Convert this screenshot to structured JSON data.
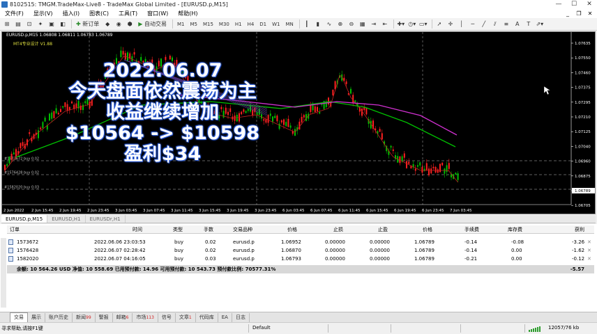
{
  "window": {
    "title": "8102515: TMGM.TradeMax-Live8 - TradeMax Global Limited - [EURUSD.p,M15]"
  },
  "menu": [
    "文件(F)",
    "显示(V)",
    "插入(I)",
    "图表(C)",
    "工具(T)",
    "窗口(W)",
    "帮助(H)"
  ],
  "toolbar": {
    "new_order": "新订单",
    "autotrade": "自动交易",
    "timeframes": [
      "M1",
      "M5",
      "M15",
      "M30",
      "H1",
      "H4",
      "D1",
      "W1",
      "MN"
    ]
  },
  "chart": {
    "symbol_header": "EURUSD.p,M15  1.06808 1.06811 1.06783 1.06789",
    "indicator_label": "MT4专业设计 V1.88",
    "overlay_lines": [
      "2022.06.07",
      "今天盘面依然震荡为主",
      "收益继续增加",
      "$10564 -> $10598",
      "盈利$34"
    ],
    "price_labels": [
      "1.07635",
      "1.07550",
      "1.07460",
      "1.07375",
      "1.07295",
      "1.07210",
      "1.07125",
      "1.07040",
      "1.06960",
      "1.06875",
      "1.06789",
      "1.06705"
    ],
    "current_price": "1.06789",
    "time_labels": [
      "2 Jun 2022",
      "2 Jun 15:45",
      "2 Jun 19:45",
      "2 Jun 23:45",
      "3 Jun 03:45",
      "3 Jun 07:45",
      "3 Jun 11:45",
      "3 Jun 15:45",
      "3 Jun 19:45",
      "3 Jun 23:45",
      "6 Jun 03:45",
      "6 Jun 07:45",
      "6 Jun 11:45",
      "6 Jun 15:45",
      "6 Jun 19:45",
      "6 Jun 23:45",
      "7 Jun 03:45"
    ],
    "order_lines": [
      "#1573672 buy 0.02",
      "#1576428 buy 0.02",
      "#1582020 buy 0.03"
    ],
    "colors": {
      "up_candle": "#00c000",
      "down_candle": "#ff2020",
      "ma_magenta": "#d030d0",
      "ma_green": "#00c000",
      "ma_red": "#c02020",
      "order_line": "#808080"
    }
  },
  "chart_tabs": [
    "EURUSD.p,M15",
    "EURUSD,H1",
    "EURUSDr,H1"
  ],
  "terminal": {
    "columns": [
      "订单",
      "时间",
      "类型",
      "手数",
      "交易品种",
      "价格",
      "止损",
      "止盈",
      "价格",
      "手续费",
      "库存费",
      "获利"
    ],
    "orders": [
      {
        "ticket": "1573672",
        "time": "2022.06.06 23:03:53",
        "type": "buy",
        "lots": "0.02",
        "symbol": "eurusd.p",
        "open_price": "1.06952",
        "sl": "0.00000",
        "tp": "0.00000",
        "price": "1.06789",
        "commission": "-0.14",
        "swap": "-0.08",
        "profit": "-3.26"
      },
      {
        "ticket": "1576428",
        "time": "2022.06.07 02:28:42",
        "type": "buy",
        "lots": "0.02",
        "symbol": "eurusd.p",
        "open_price": "1.06870",
        "sl": "0.00000",
        "tp": "0.00000",
        "price": "1.06789",
        "commission": "-0.14",
        "swap": "0.00",
        "profit": "-1.62"
      },
      {
        "ticket": "1582020",
        "time": "2022.06.07 04:16:05",
        "type": "buy",
        "lots": "0.03",
        "symbol": "eurusd.p",
        "open_price": "1.06793",
        "sl": "0.00000",
        "tp": "0.00000",
        "price": "1.06789",
        "commission": "-0.21",
        "swap": "0.00",
        "profit": "-0.12"
      }
    ],
    "balance_text": "余额: 10 564.26 USD  净值: 10 558.69  已用预付款: 14.96  可用预付款: 10 543.73  预付款比例: 70577.31%",
    "total_profit": "-5.57"
  },
  "bottom_tabs": [
    {
      "label": "交易",
      "badge": ""
    },
    {
      "label": "展示",
      "badge": ""
    },
    {
      "label": "账户历史",
      "badge": ""
    },
    {
      "label": "新闻",
      "badge": "99"
    },
    {
      "label": "警报",
      "badge": ""
    },
    {
      "label": "邮箱",
      "badge": "6"
    },
    {
      "label": "市场",
      "badge": "113"
    },
    {
      "label": "信号",
      "badge": ""
    },
    {
      "label": "文章",
      "badge": "1"
    },
    {
      "label": "代码库",
      "badge": ""
    },
    {
      "label": "EA",
      "badge": ""
    },
    {
      "label": "日志",
      "badge": ""
    }
  ],
  "status": {
    "help": "寻求帮助,请按F1键",
    "profile": "Default",
    "traffic": "12057/76 kb"
  }
}
